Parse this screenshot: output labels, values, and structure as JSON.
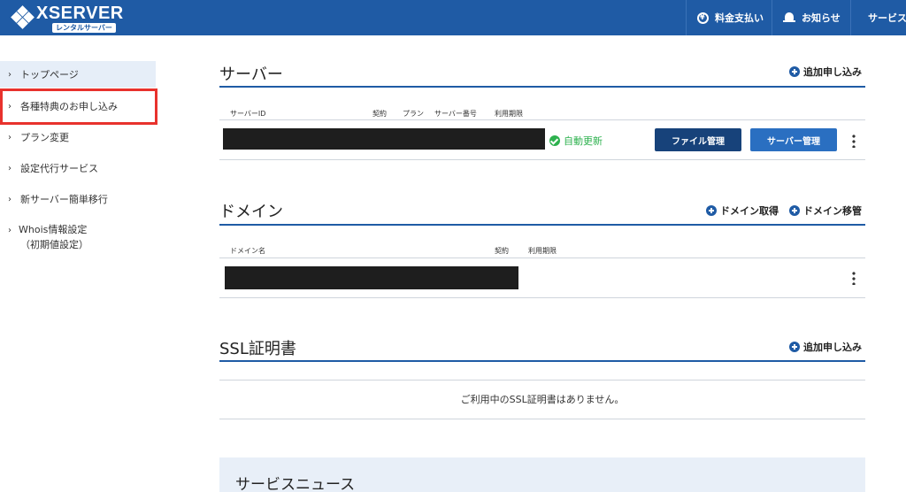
{
  "header": {
    "logo_text": "XSERVER",
    "logo_sub": "レンタルサーバー",
    "billing_label": "料金支払い",
    "notifications_label": "お知らせ",
    "services_label": "サービス"
  },
  "sidebar": {
    "items": [
      {
        "label": "トップページ"
      },
      {
        "label": "各種特典のお申し込み"
      },
      {
        "label": "プラン変更"
      },
      {
        "label": "設定代行サービス"
      },
      {
        "label": "新サーバー簡単移行"
      }
    ],
    "whois_line1": "Whois情報設定",
    "whois_line2": "（初期値設定）"
  },
  "server_section": {
    "title": "サーバー",
    "add_label": "追加申し込み",
    "columns": {
      "server_id": "サーバーID",
      "contract": "契約",
      "plan": "プラン",
      "server_no": "サーバー番号",
      "expiry": "利用期限"
    },
    "auto_renew": "自動更新",
    "file_manage_btn": "ファイル管理",
    "server_manage_btn": "サーバー管理"
  },
  "domain_section": {
    "title": "ドメイン",
    "acquire_label": "ドメイン取得",
    "transfer_label": "ドメイン移管",
    "columns": {
      "domain_name": "ドメイン名",
      "contract": "契約",
      "expiry": "利用期限"
    }
  },
  "ssl_section": {
    "title": "SSL証明書",
    "add_label": "追加申し込み",
    "empty_message": "ご利用中のSSL証明書はありません。"
  },
  "news_section": {
    "title": "サービスニュース"
  },
  "colors": {
    "header_bg": "#1f5ba5",
    "accent": "#1f5ba5",
    "highlight_border": "#e8322d",
    "renew_green": "#2db14e"
  }
}
